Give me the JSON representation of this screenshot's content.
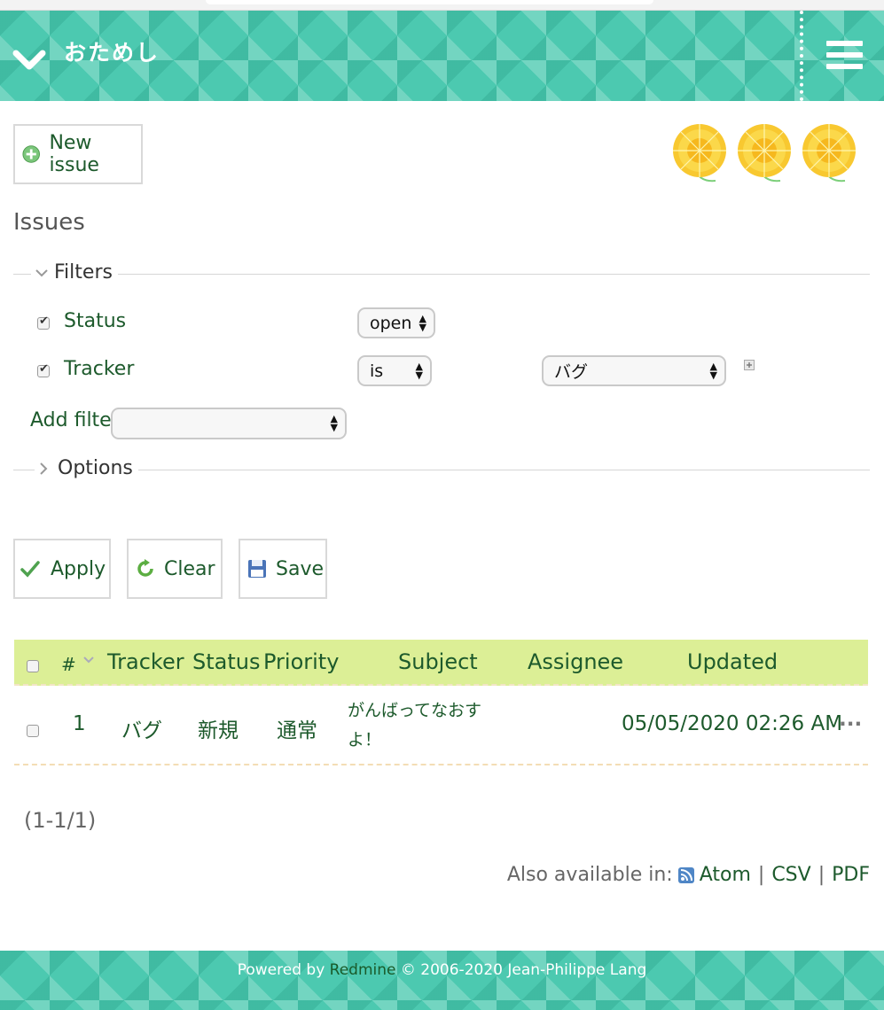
{
  "header": {
    "project_title": "おためし"
  },
  "toolbar": {
    "new_issue_label": "New issue"
  },
  "page": {
    "title": "Issues"
  },
  "filters": {
    "legend": "Filters",
    "status_label": "Status",
    "status_operator": "open",
    "tracker_label": "Tracker",
    "tracker_operator": "is",
    "tracker_value": "バグ",
    "add_filter_label": "Add filter",
    "add_filter_value": ""
  },
  "options": {
    "legend": "Options"
  },
  "actions": {
    "apply": "Apply",
    "clear": "Clear",
    "save": "Save"
  },
  "table": {
    "columns": {
      "id": "#",
      "tracker": "Tracker",
      "status": "Status",
      "priority": "Priority",
      "subject": "Subject",
      "assignee": "Assignee",
      "updated": "Updated"
    },
    "rows": [
      {
        "id": "1",
        "tracker": "バグ",
        "status": "新規",
        "priority": "通常",
        "subject_line1": "がんばってなおす",
        "subject_line2": "よ！",
        "assignee": "",
        "updated": "05/05/2020 02:26 AM",
        "more": "..."
      }
    ]
  },
  "pagination": {
    "count": "(1-1/1)"
  },
  "export": {
    "label": "Also available in:",
    "atom": "Atom",
    "csv": "CSV",
    "pdf": "PDF",
    "separator": "|"
  },
  "footer": {
    "powered_by": "Powered by",
    "redmine": "Redmine",
    "copyright": "© 2006-2020 Jean-Philippe Lang"
  },
  "colors": {
    "header": "#4cc9b0",
    "table_header": "#dcef96",
    "link": "#1d5a2c"
  },
  "icons": [
    "collapse-chevron-icon",
    "hamburger-menu-icon",
    "add-circle-icon",
    "checkmark-icon",
    "refresh-icon",
    "floppy-disk-icon",
    "feed-icon",
    "plus-small-icon",
    "sort-desc-icon"
  ]
}
